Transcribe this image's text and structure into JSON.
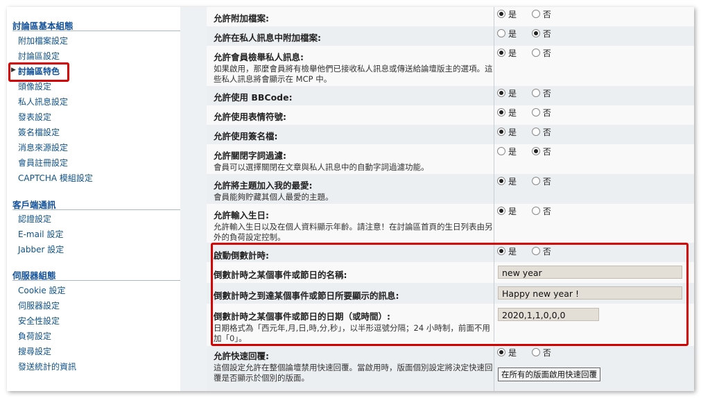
{
  "sidebar": {
    "sections": [
      {
        "title": "討論區基本組態",
        "items": [
          "附加檔案設定",
          "討論區設定",
          "討論區特色",
          "頭像設定",
          "私人訊息設定",
          "發表設定",
          "簽名檔設定",
          "消息來源設定",
          "會員註冊設定",
          "CAPTCHA 模組設定"
        ],
        "active_index": 2
      },
      {
        "title": "客戶端通訊",
        "items": [
          "認證設定",
          "E-mail 設定",
          "Jabber 設定"
        ]
      },
      {
        "title": "伺服器組態",
        "items": [
          "Cookie 設定",
          "伺服器設定",
          "安全性設定",
          "負荷設定",
          "搜尋設定",
          "發送統計的資訊"
        ]
      }
    ]
  },
  "radio_labels": {
    "yes": "是",
    "no": "否"
  },
  "settings": [
    {
      "title": "允許附加檔案:",
      "desc": "",
      "value": "yes"
    },
    {
      "title": "允許在私人訊息中附加檔案:",
      "desc": "",
      "value": "no"
    },
    {
      "title": "允許會員檢舉私人訊息:",
      "desc": "如果啟用，那麼會員將有檢舉他們已接收私人訊息或傳送給論壇版主的選項。這些私人訊息將會顯示在 MCP 中。",
      "value": "yes"
    },
    {
      "title": "允許使用 BBCode:",
      "desc": "",
      "value": "yes"
    },
    {
      "title": "允許使用表情符號:",
      "desc": "",
      "value": "yes"
    },
    {
      "title": "允許使用簽名檔:",
      "desc": "",
      "value": "yes"
    },
    {
      "title": "允許關閉字詞過濾:",
      "desc": "會員可以選擇關閉在文章與私人訊息中的自動字詞過濾功能。",
      "value": "no"
    },
    {
      "title": "允許將主題加入我的最愛:",
      "desc": "會員能夠貯藏其個人最愛的主題。",
      "value": "yes"
    },
    {
      "title": "允許輸入生日:",
      "desc": "允許輸入生日以及在個人資料顯示年齡。請注意！在討論區首頁的生日列表由另外的負荷設定控制。",
      "value": "yes"
    }
  ],
  "countdown": {
    "enable": {
      "title": "啟動倒數計時:",
      "value": "yes"
    },
    "event_name": {
      "title": "倒數計時之某個事件或節日的名稱:",
      "value": "new year"
    },
    "event_message": {
      "title": "倒數計時之到達某個事件或節日所要顯示的訊息:",
      "value": "Happy new year !"
    },
    "event_date": {
      "title": "倒數計時之某個事件或節日的日期（或時間）:",
      "desc": "日期格式為「西元年,月,日,時,分,秒」，以半形逗號分隔；24 小時制，前面不用加「0」。",
      "value": "2020,1,1,0,0,0"
    }
  },
  "quick_reply": {
    "title": "允許快速回覆:",
    "desc": "這個設定允許在整個論壇禁用快速回覆。當啟用時，版面個別設定將決定快速回覆是否顯示於個別的版面。",
    "value": "yes",
    "button_label": "在所有的版面啟用快速回覆"
  },
  "colors": {
    "highlight": "#d40000",
    "link": "#105289",
    "heading": "#115098"
  }
}
